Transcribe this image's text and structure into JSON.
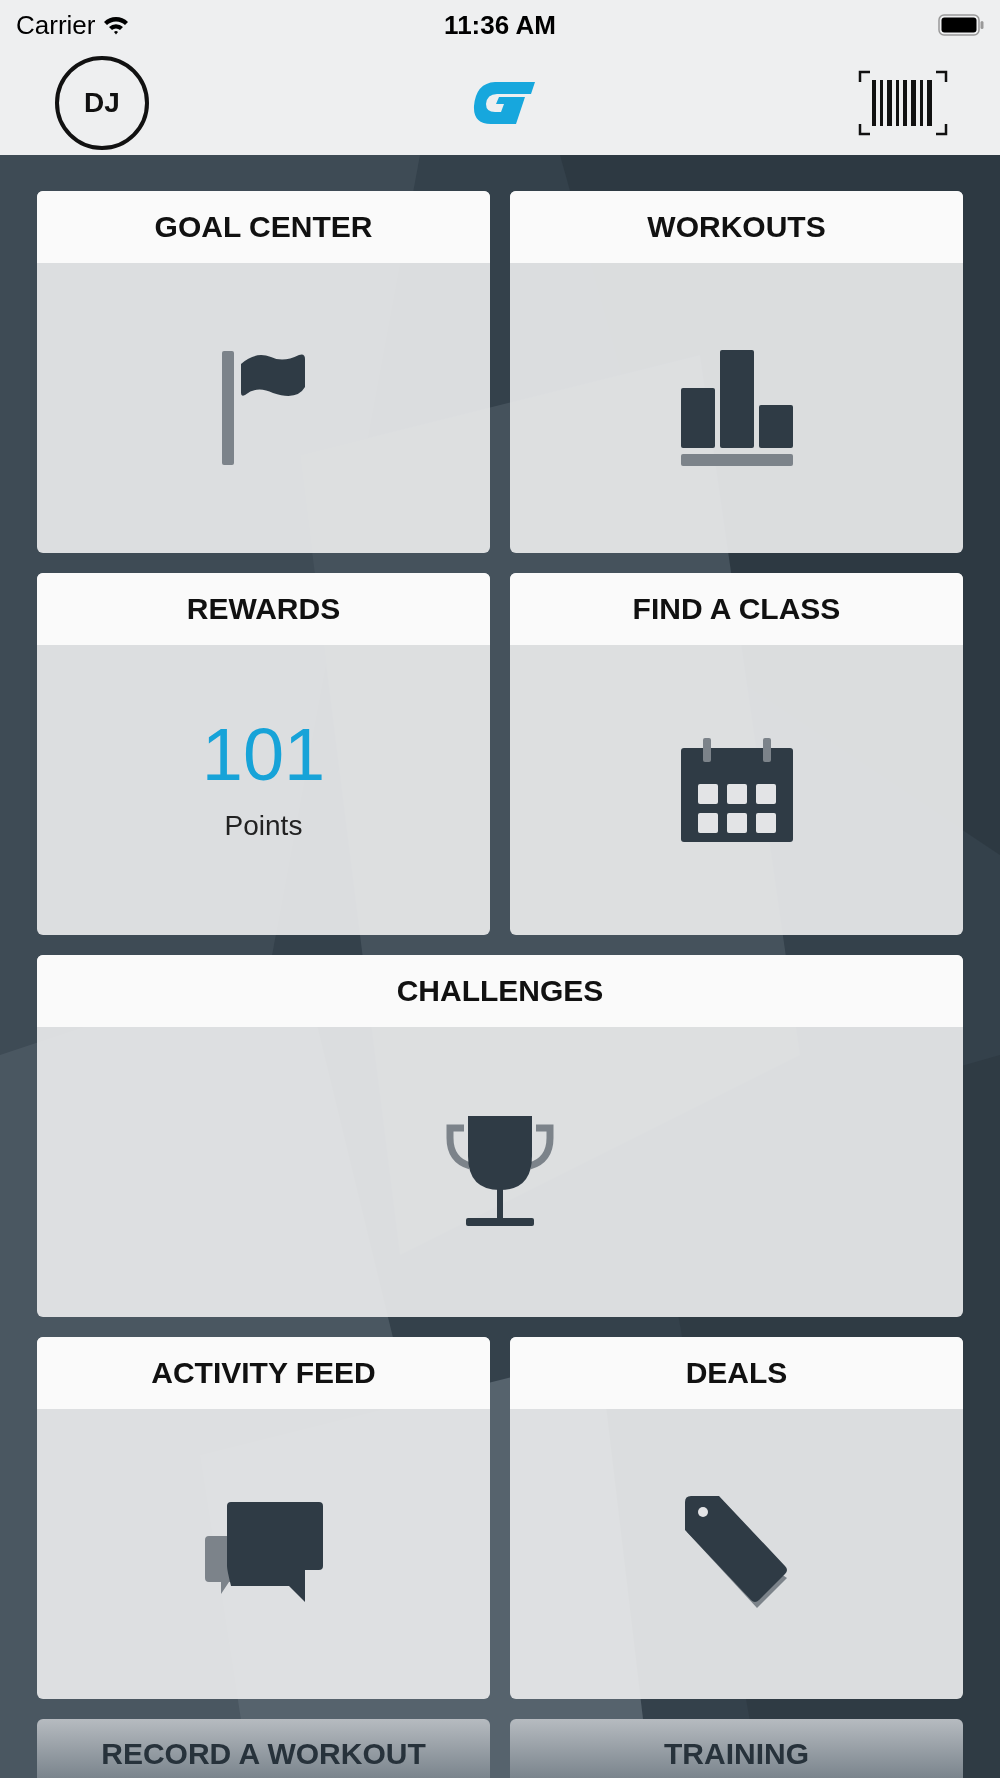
{
  "status_bar": {
    "carrier": "Carrier",
    "time": "11:36 AM"
  },
  "nav": {
    "avatar_initials": "DJ"
  },
  "tiles": [
    {
      "title": "GOAL CENTER",
      "kind": "flag",
      "wide": false
    },
    {
      "title": "WORKOUTS",
      "kind": "chart",
      "wide": false
    },
    {
      "title": "REWARDS",
      "kind": "points",
      "wide": false,
      "value": "101",
      "unit": "Points"
    },
    {
      "title": "FIND A CLASS",
      "kind": "calendar",
      "wide": false
    },
    {
      "title": "CHALLENGES",
      "kind": "trophy",
      "wide": true
    },
    {
      "title": "ACTIVITY FEED",
      "kind": "chat",
      "wide": false
    },
    {
      "title": "DEALS",
      "kind": "tag",
      "wide": false
    },
    {
      "title": "RECORD A WORKOUT",
      "kind": "cut",
      "wide": false
    },
    {
      "title": "TRAINING",
      "kind": "cut",
      "wide": false
    }
  ]
}
